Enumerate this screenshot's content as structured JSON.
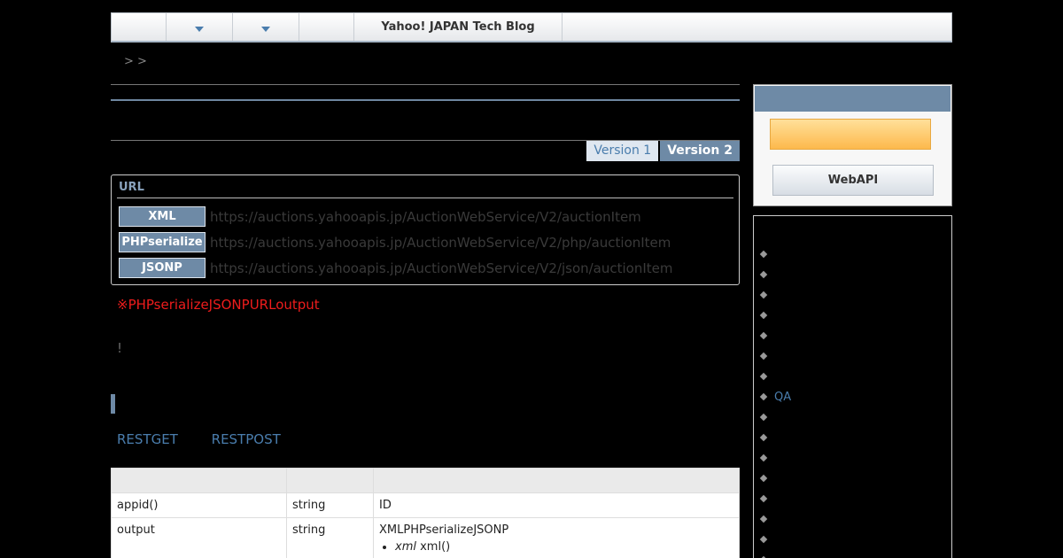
{
  "topnav": {
    "brand": "Yahoo! JAPAN Tech Blog"
  },
  "breadcrumb": {
    "text": "> >"
  },
  "version_tabs": {
    "v1": "Version 1",
    "v2": "Version 2"
  },
  "url_box": {
    "label": "URL",
    "rows": [
      {
        "format": "XML",
        "url": "https://auctions.yahooapis.jp/AuctionWebService/V2/auctionItem"
      },
      {
        "format": "PHPserialize",
        "url": "https://auctions.yahooapis.jp/AuctionWebService/V2/php/auctionItem"
      },
      {
        "format": "JSONP",
        "url": "https://auctions.yahooapis.jp/AuctionWebService/V2/json/auctionItem"
      }
    ]
  },
  "note": "※PHPserializeJSONPURLoutput",
  "exclaim": "!",
  "links": {
    "get": "RESTGET",
    "post": "RESTPOST"
  },
  "params_table": {
    "rows": [
      {
        "name": "appid()",
        "type": "string",
        "desc": "ID"
      },
      {
        "name": "output",
        "type": "string",
        "desc": "XMLPHPserializeJSONP",
        "bullet_em": "xml",
        "bullet_text": " xml()"
      }
    ]
  },
  "sidebar": {
    "webapi_button": "WebAPI",
    "nav_items": [
      "",
      "",
      "",
      "",
      "",
      "",
      "",
      "QA",
      "",
      "",
      "",
      "",
      "",
      "",
      "",
      ""
    ]
  },
  "colors": {
    "accent": "#6e8aa6",
    "link": "#4a7dad",
    "warning": "#ee1c1c"
  }
}
